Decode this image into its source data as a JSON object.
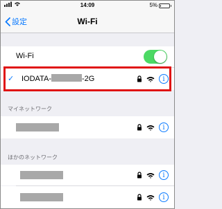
{
  "status_bar": {
    "time": "14:09",
    "battery": "5%",
    "battery_level": 0.05
  },
  "nav": {
    "back_label": "設定",
    "title": "Wi-Fi"
  },
  "wifi_toggle": {
    "label": "Wi-Fi",
    "on": true,
    "color": "#4cd964"
  },
  "connected_network": {
    "name_prefix": "IODATA-",
    "name_suffix": "-2G",
    "check": "✓"
  },
  "sections": {
    "my_networks": "マイネットワーク",
    "other_networks": "ほかのネットワーク"
  },
  "info_symbol": "i",
  "colors": {
    "accent": "#0a7aff",
    "highlight": "#e01414"
  }
}
